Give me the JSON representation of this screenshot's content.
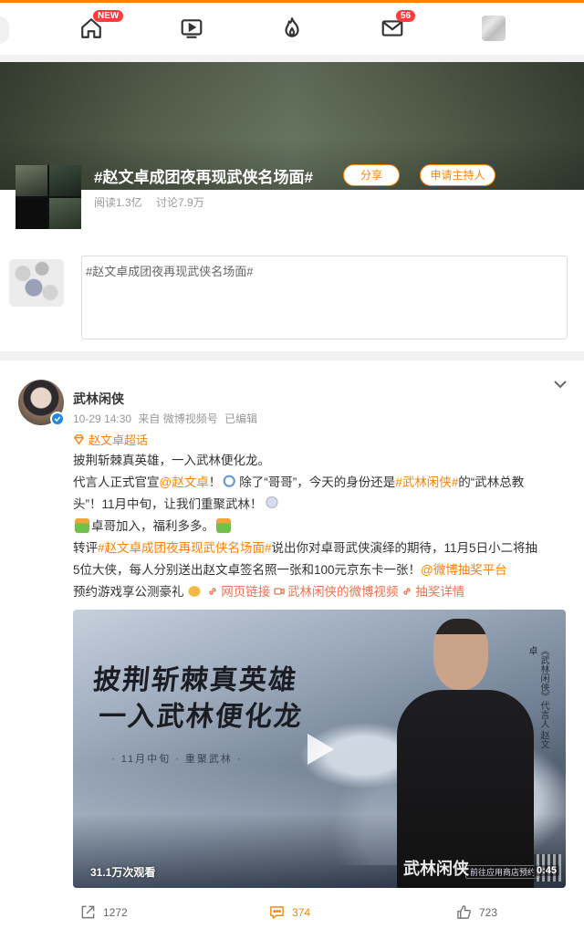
{
  "nav": {
    "home_badge": "NEW",
    "messages_badge": "56",
    "icons": [
      "home-icon",
      "video-icon",
      "hot-icon",
      "mail-icon",
      "user-avatar"
    ]
  },
  "topic": {
    "title": "#赵文卓成团夜再现武侠名场面#",
    "share_label": "分享",
    "apply_host_label": "申请主持人",
    "reads": "阅读1.3亿",
    "discussions": "讨论7.9万",
    "compose_text": "#赵文卓成团夜再现武侠名场面#"
  },
  "post": {
    "author": "武林闲侠",
    "time": "10-29 14:30",
    "source": "来自 微博视频号",
    "edited": "已编辑",
    "supertopic": "赵文卓超话",
    "lines": {
      "l1": "披荆斩棘真英雄，一入武林便化龙。",
      "l2a": "代言人正式官宣",
      "l2b": "@赵文卓",
      "l2c": "！",
      "l2d": "除了“哥哥”，今天的身份还是",
      "l2e": "#武林闲侠#",
      "l2f": "的“武林总教",
      "l3a": "头”！11月中旬，让我们重聚武林！",
      "l4": "卓哥加入，福利多多。",
      "l5a": "转评",
      "l5b": "#赵文卓成团夜再现武侠名场面#",
      "l5c": "说出你对卓哥武侠演绎的期待，11月5日小二将抽",
      "l6a": "5位大侠，每人分别送出赵文卓签名照一张和100元京东卡一张！",
      "l6b": "@微博抽奖平台",
      "l7a": "预约游戏享公测豪礼",
      "l7b": "网页链接",
      "l7c": "武林闲侠的微博视频",
      "l7d": "抽奖详情"
    },
    "video": {
      "headline_1": "披荆斩棘真英雄",
      "headline_2": "一入武林便化龙",
      "subtitle": "· 11月中旬 · 重聚武林 ·",
      "side_text": "《武林闲侠》代言人 赵文卓",
      "logo": "武林闲侠",
      "store": "前往应用商店预约",
      "views": "31.1万次观看",
      "duration": "0:45"
    },
    "actions": {
      "reposts": "1272",
      "comments": "374",
      "likes": "723"
    }
  },
  "colors": {
    "accent": "#ff8200",
    "link": "#eb7350",
    "verified": "#1e88e5"
  }
}
